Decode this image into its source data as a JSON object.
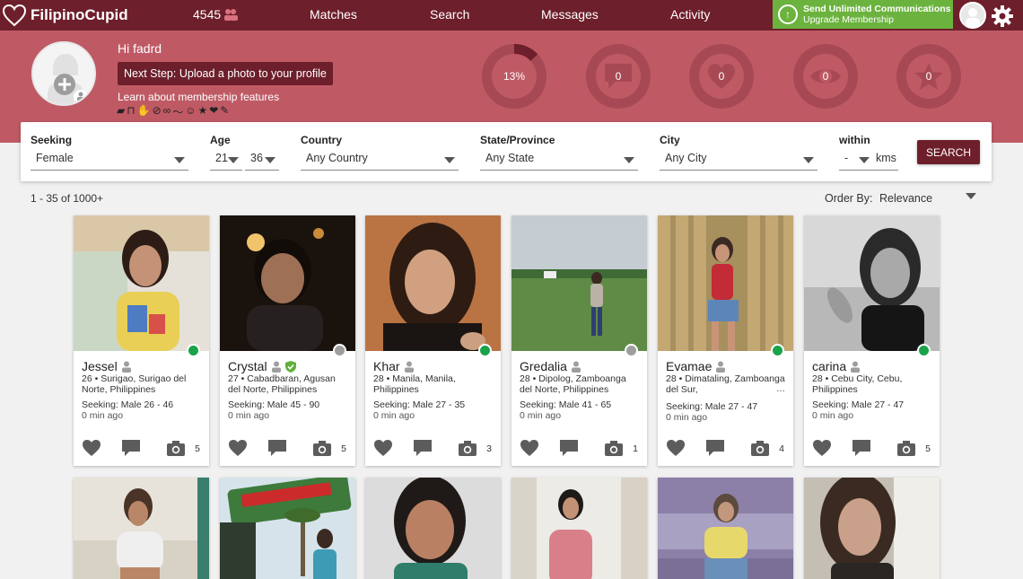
{
  "nav": {
    "logo": "FilipinoCupid",
    "count": "4545",
    "links": [
      "Matches",
      "Search",
      "Messages",
      "Activity"
    ],
    "upgrade_title": "Send Unlimited Communications",
    "upgrade_sub": "Upgrade Membership"
  },
  "hero": {
    "greeting": "Hi fadrd",
    "next_step": "Next Step: Upload a photo to your profile",
    "learn": "Learn about membership features",
    "stats": [
      {
        "value": "13%",
        "icon": "progress-ring",
        "progress": 0.13
      },
      {
        "value": "0",
        "icon": "message-icon"
      },
      {
        "value": "0",
        "icon": "heart-icon"
      },
      {
        "value": "0",
        "icon": "eye-icon"
      },
      {
        "value": "0",
        "icon": "star-icon"
      }
    ]
  },
  "search": {
    "seeking_label": "Seeking",
    "seeking_value": "Female",
    "age_label": "Age",
    "age_min": "21",
    "age_max": "36",
    "country_label": "Country",
    "country_value": "Any Country",
    "state_label": "State/Province",
    "state_value": "Any State",
    "city_label": "City",
    "city_value": "Any City",
    "within_label": "within",
    "within_value": "-",
    "units": "kms",
    "button": "SEARCH"
  },
  "results": {
    "count": "1 - 35 of 1000+",
    "order_label": "Order By:",
    "order_value": "Relevance"
  },
  "colors": {
    "brand": "#6d1f2b",
    "hero": "#bf5a65",
    "online": "#1aa34a",
    "offline": "#9e9e9e",
    "upgrade": "#6bb33e"
  },
  "profiles": [
    {
      "name": "Jessel",
      "verified": false,
      "online": true,
      "location": "26 • Surigao, Surigao del Norte, Philippines",
      "seeking": "Seeking: Male 26 - 46",
      "time": "0 min ago",
      "photos": "5"
    },
    {
      "name": "Crystal",
      "verified": true,
      "online": false,
      "location": "27 • Cabadbaran, Agusan del Norte, Philippines",
      "seeking": "Seeking: Male 45 - 90",
      "time": "0 min ago",
      "photos": "5"
    },
    {
      "name": "Khar",
      "verified": false,
      "online": true,
      "location": "28 • Manila, Manila, Philippines",
      "seeking": "Seeking: Male 27 - 35",
      "time": "0 min ago",
      "photos": "3"
    },
    {
      "name": "Gredalia",
      "verified": false,
      "online": false,
      "location": "28 • Dipolog, Zamboanga del Norte, Philippines",
      "seeking": "Seeking: Male 41 - 65",
      "time": "0 min ago",
      "photos": "1"
    },
    {
      "name": "Evamae",
      "verified": false,
      "online": true,
      "location": "28 • Dimataling, Zamboanga del Sur,",
      "seeking": "Seeking: Male 27 - 47",
      "time": "0 min ago",
      "photos": "4"
    },
    {
      "name": "carina",
      "verified": false,
      "online": true,
      "location": "28 • Cebu City, Cebu, Philippines",
      "seeking": "Seeking: Male 27 - 47",
      "time": "0 min ago",
      "photos": "5"
    }
  ]
}
